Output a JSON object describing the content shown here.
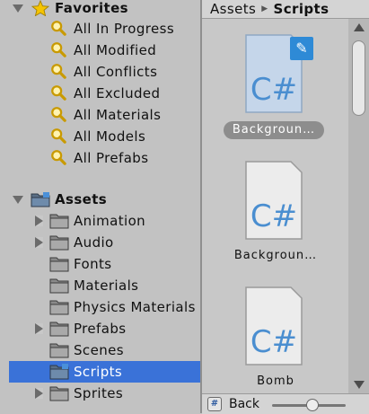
{
  "tree": {
    "favorites": {
      "label": "Favorites",
      "icon": "star-icon",
      "items": [
        {
          "label": "All In Progress",
          "icon": "search-icon"
        },
        {
          "label": "All Modified",
          "icon": "search-icon"
        },
        {
          "label": "All Conflicts",
          "icon": "search-icon"
        },
        {
          "label": "All Excluded",
          "icon": "search-icon"
        },
        {
          "label": "All Materials",
          "icon": "search-icon"
        },
        {
          "label": "All Models",
          "icon": "search-icon"
        },
        {
          "label": "All Prefabs",
          "icon": "search-icon"
        }
      ]
    },
    "assets": {
      "label": "Assets",
      "icon": "folder-icon",
      "items": [
        {
          "label": "Animation",
          "expandable": true
        },
        {
          "label": "Audio",
          "expandable": true
        },
        {
          "label": "Fonts",
          "expandable": false
        },
        {
          "label": "Materials",
          "expandable": false
        },
        {
          "label": "Physics Materials",
          "expandable": false
        },
        {
          "label": "Prefabs",
          "expandable": true
        },
        {
          "label": "Scenes",
          "expandable": false
        },
        {
          "label": "Scripts",
          "expandable": false,
          "selected": true
        },
        {
          "label": "Sprites",
          "expandable": true
        }
      ]
    }
  },
  "breadcrumb": {
    "root": "Assets",
    "current": "Scripts"
  },
  "files": [
    {
      "name": "Backgroun…",
      "type_glyph": "C#",
      "selected": true,
      "editing": true
    },
    {
      "name": "Backgroun…",
      "type_glyph": "C#",
      "selected": false,
      "editing": false
    },
    {
      "name": "Bomb",
      "type_glyph": "C#",
      "selected": false,
      "editing": false
    }
  ],
  "footer": {
    "label": "Back",
    "icon_glyph": "#"
  },
  "colors": {
    "selection": "#3a72d8",
    "badge": "#2e8ad6",
    "csharp_blue": "#4a8ed0"
  }
}
